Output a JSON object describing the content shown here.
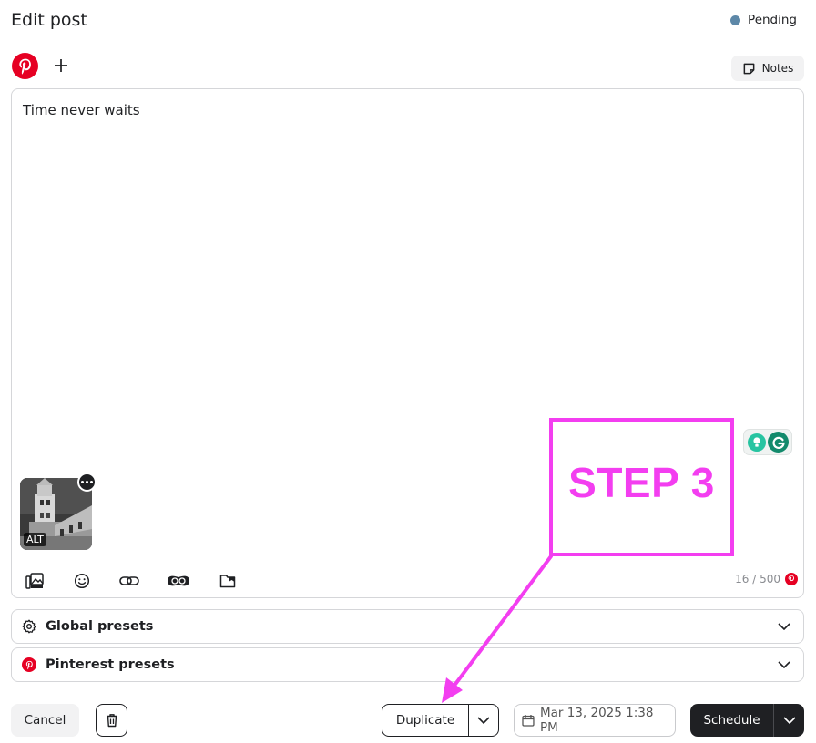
{
  "header": {
    "title": "Edit post",
    "status_label": "Pending",
    "status_color": "#5d88a8"
  },
  "accounts": {
    "active_icon": "pinterest-icon",
    "add_icon": "plus-icon"
  },
  "notes": {
    "label": "Notes",
    "icon": "note-icon"
  },
  "editor": {
    "text": "Time never waits",
    "media": {
      "alt_label": "ALT",
      "more_icon": "ellipsis-icon"
    },
    "toolbar": [
      {
        "name": "media-library-icon"
      },
      {
        "name": "emoji-icon"
      },
      {
        "name": "link-icon"
      },
      {
        "name": "canva-icon"
      },
      {
        "name": "folder-icon"
      }
    ],
    "char_count": "16 / 500",
    "grammarly_icons": [
      "suggestion-bulb-icon",
      "grammarly-icon"
    ]
  },
  "presets": [
    {
      "label": "Global presets",
      "icon": "gear-icon"
    },
    {
      "label": "Pinterest presets",
      "icon": "pinterest-icon"
    }
  ],
  "footer": {
    "cancel_label": "Cancel",
    "delete_icon": "trash-icon",
    "duplicate_label": "Duplicate",
    "date_label": "Mar 13, 2025 1:38 PM",
    "schedule_label": "Schedule"
  },
  "annotation": {
    "step_label": "STEP 3",
    "color": "#f33ef0"
  },
  "colors": {
    "pinterest_red": "#e60023",
    "dark": "#1f2023",
    "border": "#d5d6d9"
  }
}
